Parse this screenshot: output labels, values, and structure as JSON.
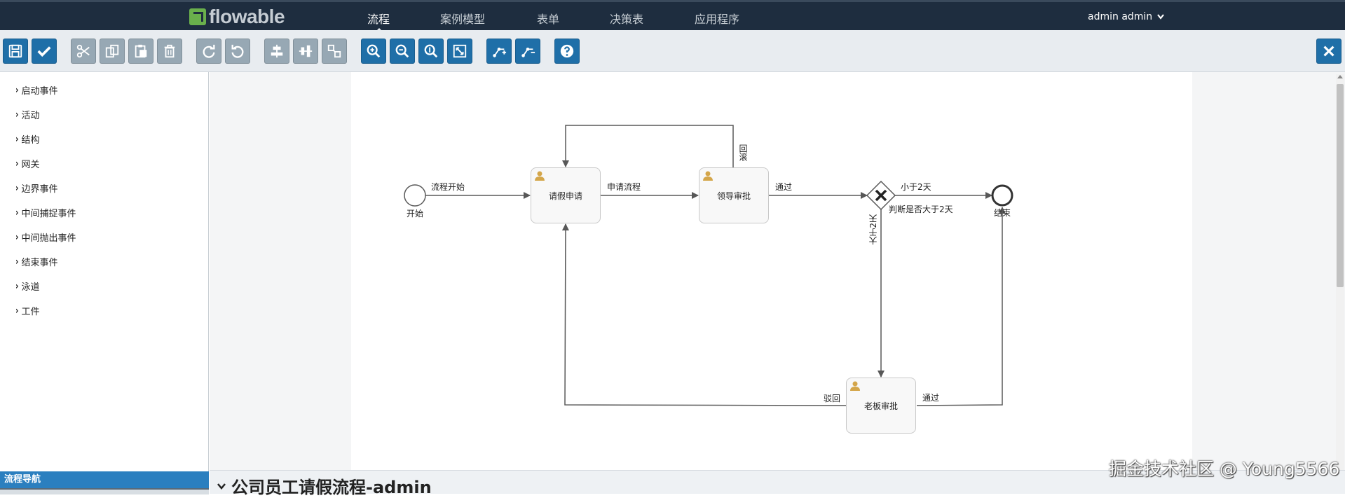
{
  "app": {
    "logo_text": "flowable",
    "nav": [
      {
        "label": "流程",
        "active": true
      },
      {
        "label": "案例模型",
        "active": false
      },
      {
        "label": "表单",
        "active": false
      },
      {
        "label": "决策表",
        "active": false
      },
      {
        "label": "应用程序",
        "active": false
      }
    ],
    "user_menu": "admin admin"
  },
  "toolbar": {
    "buttons": [
      {
        "name": "save",
        "icon": "save-icon",
        "style": "blue"
      },
      {
        "name": "validate",
        "icon": "check-icon",
        "style": "blue"
      },
      {
        "name": "cut",
        "icon": "scissors-icon",
        "style": "gray"
      },
      {
        "name": "copy",
        "icon": "copy-icon",
        "style": "gray"
      },
      {
        "name": "paste",
        "icon": "paste-icon",
        "style": "gray"
      },
      {
        "name": "delete",
        "icon": "trash-icon",
        "style": "gray"
      },
      {
        "name": "redo",
        "icon": "redo-icon",
        "style": "gray"
      },
      {
        "name": "undo",
        "icon": "undo-icon",
        "style": "gray"
      },
      {
        "name": "align-horizontal",
        "icon": "align-horizontal-icon",
        "style": "gray"
      },
      {
        "name": "align-vertical",
        "icon": "align-vertical-icon",
        "style": "gray"
      },
      {
        "name": "same-size",
        "icon": "same-size-icon",
        "style": "gray"
      },
      {
        "name": "zoom-in",
        "icon": "zoom-in-icon",
        "style": "blue"
      },
      {
        "name": "zoom-out",
        "icon": "zoom-out-icon",
        "style": "blue"
      },
      {
        "name": "zoom-actual",
        "icon": "zoom-actual-icon",
        "style": "blue"
      },
      {
        "name": "zoom-fit",
        "icon": "zoom-fit-icon",
        "style": "blue"
      },
      {
        "name": "add-bendpoint",
        "icon": "add-bendpoint-icon",
        "style": "blue"
      },
      {
        "name": "remove-bendpoint",
        "icon": "remove-bendpoint-icon",
        "style": "blue"
      },
      {
        "name": "help",
        "icon": "help-icon",
        "style": "blue"
      },
      {
        "name": "close",
        "icon": "close-icon",
        "style": "blue"
      }
    ]
  },
  "palette": {
    "groups": [
      "启动事件",
      "活动",
      "结构",
      "网关",
      "边界事件",
      "中间捕捉事件",
      "中间抛出事件",
      "结束事件",
      "泳道",
      "工件"
    ],
    "nav_title": "流程导航"
  },
  "diagram": {
    "start_label": "开始",
    "end_label": "结束",
    "tasks": {
      "apply": "请假申请",
      "leader": "领导审批",
      "boss": "老板审批"
    },
    "flows": {
      "start": "流程开始",
      "apply": "申请流程",
      "leader_pass": "通过",
      "rollback": "回滚",
      "less_than": "小于2天",
      "gateway_name": "判断是否大于2天",
      "greater_than": "大于2天",
      "reject": "驳回",
      "boss_pass": "通过"
    }
  },
  "model": {
    "title": "公司员工请假流程-admin"
  },
  "watermark": "掘金技术社区 @ Young5566",
  "colors": {
    "navbar": "#1e2d3f",
    "toolbar_blue": "#1f6fa8",
    "toolbar_gray": "#97a8b4",
    "palette_nav": "#2b7fbf",
    "user_icon": "#d4a64a"
  }
}
